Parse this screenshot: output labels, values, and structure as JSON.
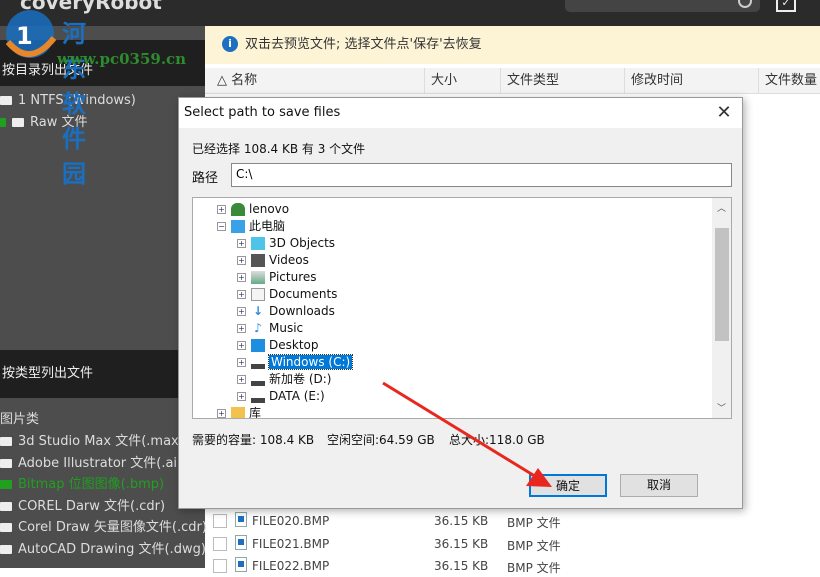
{
  "app": {
    "title": "coveryRobot"
  },
  "watermark": {
    "name": "河东软件园",
    "url": "www.pc0359.cn"
  },
  "sidebar": {
    "dir_header": "按目录列出文件",
    "dir_items": [
      "1 NTFS (Windows)",
      "Raw 文件"
    ],
    "type_header": "按类型列出文件",
    "type_category": "图片类",
    "type_items": [
      "3d Studio Max 文件(.max)",
      "Adobe Illustrator 文件(.ai)",
      "Bitmap 位图图像(.bmp)",
      "COREL Darw 文件(.cdr)",
      "Corel Draw 矢量图像文件(.cdr)",
      "AutoCAD Drawing 文件(.dwg)"
    ]
  },
  "banner": {
    "text": "双击去预览文件; 选择文件点'保存'去恢复"
  },
  "table": {
    "columns": [
      "名称",
      "大小",
      "文件类型",
      "修改时间",
      "文件数量"
    ],
    "rows": [
      {
        "name": "FILE020.BMP",
        "size": "36.15 KB",
        "type": "BMP 文件"
      },
      {
        "name": "FILE021.BMP",
        "size": "36.15 KB",
        "type": "BMP 文件"
      },
      {
        "name": "FILE022.BMP",
        "size": "36.15 KB",
        "type": "BMP 文件"
      }
    ]
  },
  "dialog": {
    "title": "Select path to save files",
    "selected_label": "已经选择 108.4 KB 有 3 个文件",
    "path_label": "路径",
    "path_value": "C:\\",
    "tree": [
      "lenovo",
      "此电脑",
      "3D Objects",
      "Videos",
      "Pictures",
      "Documents",
      "Downloads",
      "Music",
      "Desktop",
      "Windows (C:)",
      "新加卷 (D:)",
      "DATA (E:)",
      "库"
    ],
    "required_label": "需要的容量: 108.4 KB",
    "free_label": "空闲空间:64.59 GB",
    "total_label": "总大小:118.0 GB",
    "ok": "确定",
    "cancel": "取消"
  },
  "colors": {
    "accent": "#0078d7",
    "banner": "#fdf4d6",
    "selected_type": "#1fa01f",
    "arrow": "#e8281e"
  }
}
